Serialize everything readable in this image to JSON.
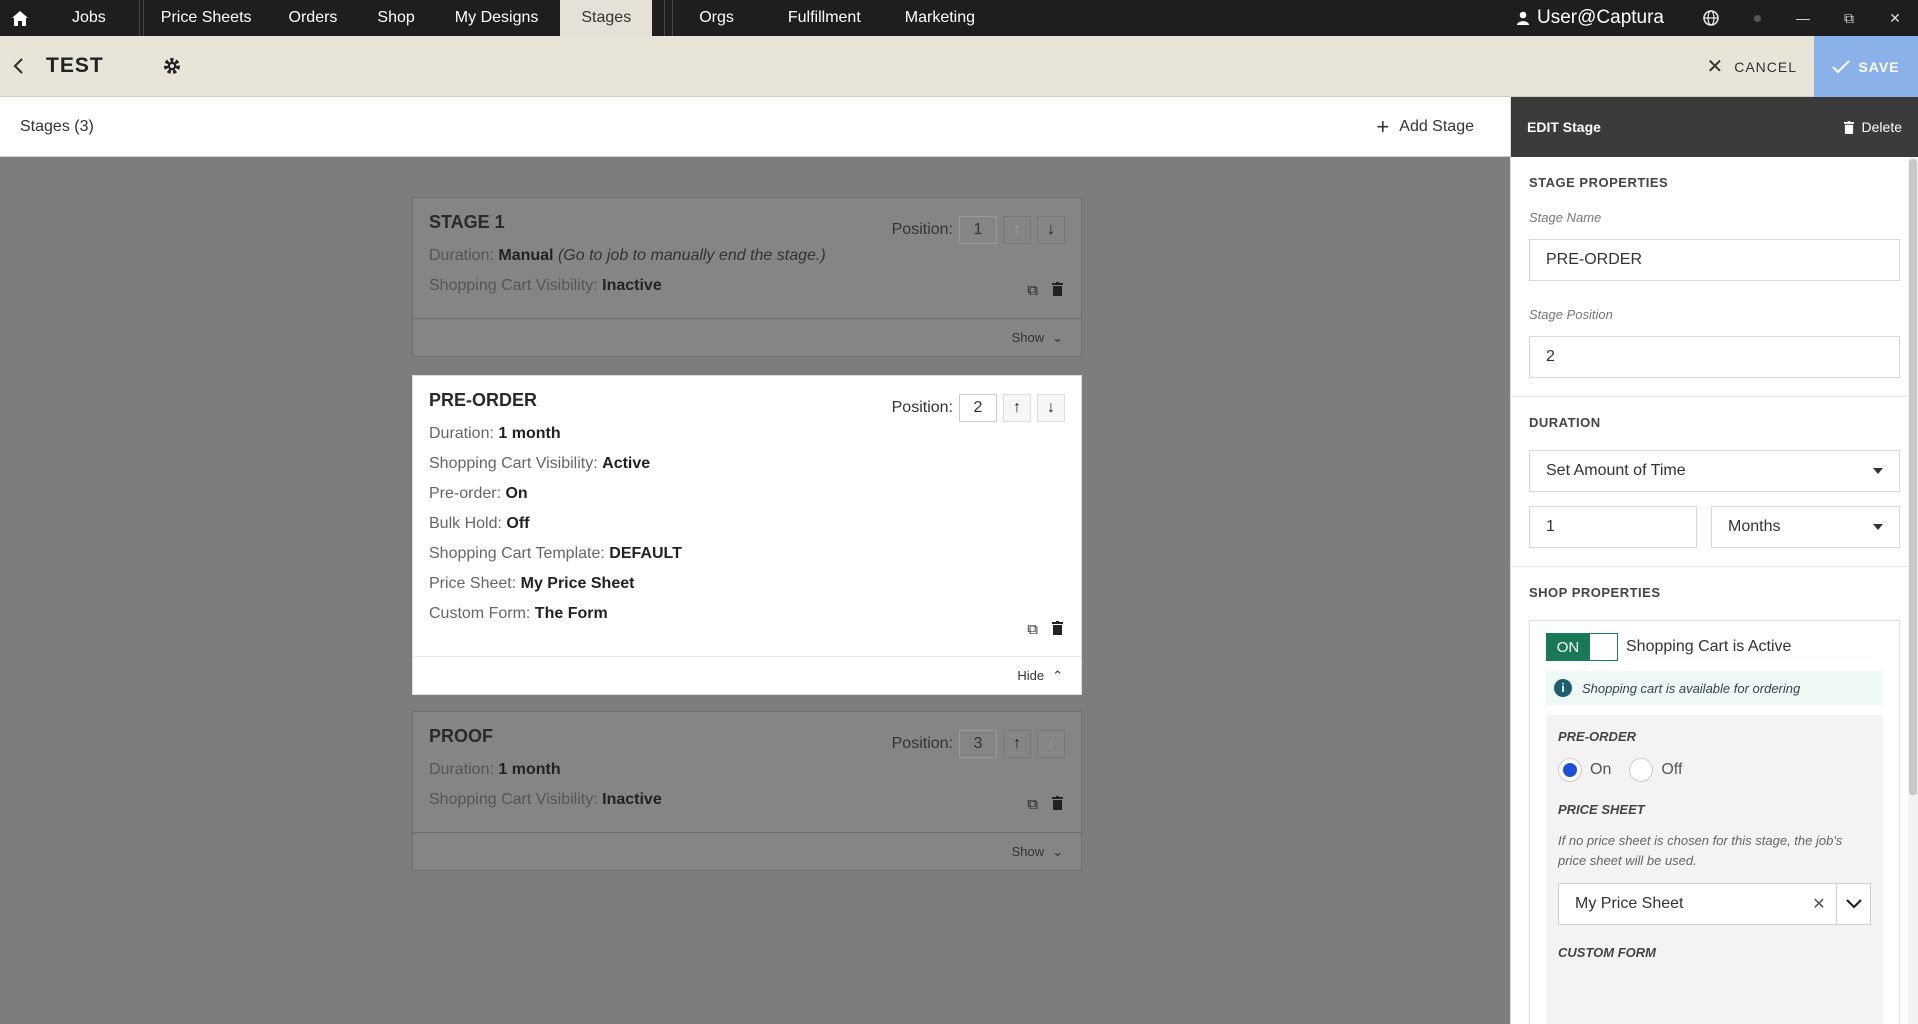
{
  "topnav": {
    "items": [
      "Jobs",
      "Price Sheets",
      "Orders",
      "Shop",
      "My Designs",
      "Stages",
      "Orgs",
      "Fulfillment",
      "Marketing"
    ],
    "active": "Stages",
    "user": "User@Captura"
  },
  "header": {
    "title": "TEST",
    "cancel_label": "CANCEL",
    "save_label": "SAVE"
  },
  "stages_header": {
    "count_label": "Stages (3)",
    "add_label": "Add Stage"
  },
  "stages": [
    {
      "name": "STAGE 1",
      "position_label": "Position:",
      "position": "1",
      "rows": [
        {
          "label": "Duration:",
          "value": "Manual",
          "note": "(Go to job to manually end the stage.)"
        },
        {
          "label": "Shopping Cart Visibility:",
          "value": "Inactive"
        }
      ],
      "toggle_label": "Show"
    },
    {
      "name": "PRE-ORDER",
      "position_label": "Position:",
      "position": "2",
      "rows": [
        {
          "label": "Duration:",
          "value": "1 month"
        },
        {
          "label": "Shopping Cart Visibility:",
          "value": "Active"
        },
        {
          "label": "Pre-order:",
          "value": "On"
        },
        {
          "label": "Bulk Hold:",
          "value": "Off"
        },
        {
          "label": "Shopping Cart Template:",
          "value": "DEFAULT"
        },
        {
          "label": "Price Sheet:",
          "value": "My Price Sheet"
        },
        {
          "label": "Custom Form:",
          "value": "The Form"
        }
      ],
      "toggle_label": "Hide"
    },
    {
      "name": "PROOF",
      "position_label": "Position:",
      "position": "3",
      "rows": [
        {
          "label": "Duration:",
          "value": "1 month"
        },
        {
          "label": "Shopping Cart Visibility:",
          "value": "Inactive"
        }
      ],
      "toggle_label": "Show"
    }
  ],
  "panel": {
    "title": "EDIT Stage",
    "delete_label": "Delete",
    "stage_properties": {
      "title": "STAGE PROPERTIES",
      "name_label": "Stage Name",
      "name_value": "PRE-ORDER",
      "position_label": "Stage Position",
      "position_value": "2"
    },
    "duration": {
      "title": "DURATION",
      "type": "Set Amount of Time",
      "amount": "1",
      "unit": "Months"
    },
    "shop_properties": {
      "title": "SHOP PROPERTIES",
      "toggle_on": "ON",
      "toggle_label": "Shopping Cart is Active",
      "info": "Shopping cart is available for ordering",
      "preorder_title": "PRE-ORDER",
      "preorder_on": "On",
      "preorder_off": "Off",
      "price_sheet_title": "PRICE SHEET",
      "price_sheet_note": "If no price sheet is chosen for this stage, the job's price sheet will be used.",
      "price_sheet_value": "My Price Sheet",
      "custom_form_title": "CUSTOM FORM"
    }
  },
  "colors": {
    "accent_save": "#8bb2e8",
    "toggle_on": "#187a55",
    "radio_selected": "#1f4fd6"
  }
}
